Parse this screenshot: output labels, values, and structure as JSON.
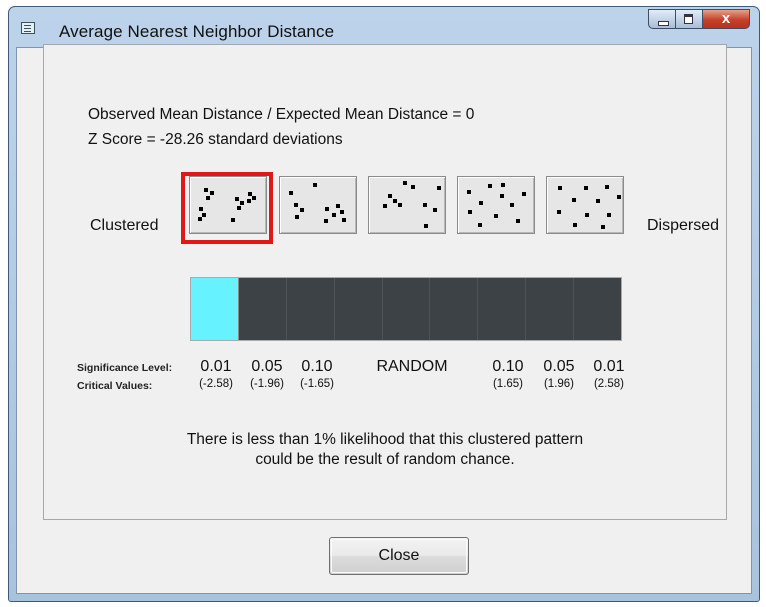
{
  "window": {
    "title": "Average Nearest Neighbor Distance",
    "close_glyph": "x"
  },
  "results": {
    "ratio_line": "Observed Mean Distance / Expected Mean Distance = 0",
    "zscore_line": "Z Score = -28.26 standard deviations"
  },
  "patterns": {
    "left_label": "Clustered",
    "right_label": "Dispersed",
    "thumbnails": [
      {
        "name": "clustered",
        "selected": true
      },
      {
        "name": "slightly-clustered",
        "selected": false
      },
      {
        "name": "random",
        "selected": false
      },
      {
        "name": "slightly-dispersed",
        "selected": false
      },
      {
        "name": "dispersed",
        "selected": false
      }
    ]
  },
  "scale": {
    "segment_count": 9,
    "active_segment_index": 0,
    "active_color": "#66f3ff",
    "inactive_color": "#3c4246",
    "significance_label": "Significance Level:",
    "critical_label": "Critical Values:",
    "significance_levels": [
      "0.01",
      "0.05",
      "0.10",
      "RANDOM",
      "0.10",
      "0.05",
      "0.01"
    ],
    "critical_values": [
      "(-2.58)",
      "(-1.96)",
      "(-1.65)",
      "",
      "(1.65)",
      "(1.96)",
      "(2.58)"
    ]
  },
  "message": {
    "line1": "There is less than 1% likelihood that this clustered pattern",
    "line2": "could be the result of random chance."
  },
  "buttons": {
    "close_label": "Close"
  },
  "colors": {
    "highlight": "#e01818"
  }
}
